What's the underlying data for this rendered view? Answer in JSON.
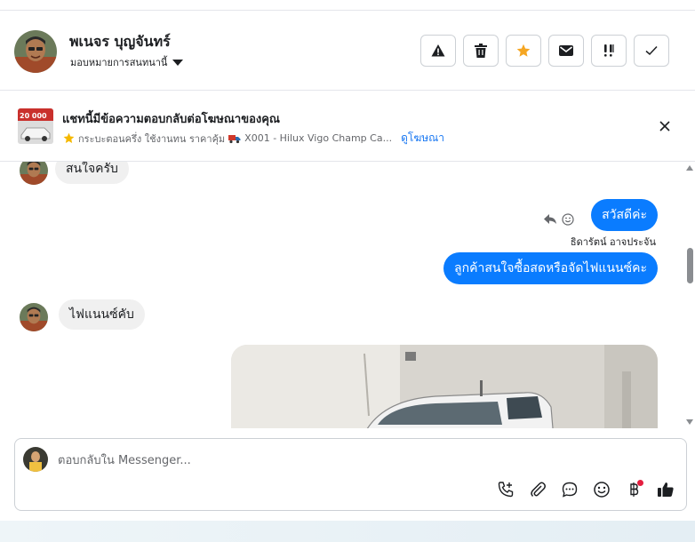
{
  "header": {
    "name": "พเนจร บุญจันทร์",
    "assign_label": "มอบหมายการสนทนานี้",
    "actions": [
      {
        "icon": "warning-icon"
      },
      {
        "icon": "trash-icon"
      },
      {
        "icon": "star-icon"
      },
      {
        "icon": "mail-icon"
      },
      {
        "icon": "priority-icon"
      },
      {
        "icon": "check-icon"
      }
    ]
  },
  "ad_banner": {
    "thumb_text": "20 000",
    "title": "แชทนี้มีข้อความตอบกลับต่อโฆษณาของคุณ",
    "subtitle": "กระบะตอนครึ่ง ใช้งานทน ราคาคุ้ม",
    "subtitle_item": "X001 - Hilux Vigo Champ Ca...",
    "link": "ดูโฆษณา"
  },
  "messages": [
    {
      "direction": "incoming",
      "text": "สนใจครับ"
    },
    {
      "direction": "outgoing",
      "text": "สวัสดีค่ะ",
      "sender": "ธิดารัตน์ อาจประจัน"
    },
    {
      "direction": "outgoing",
      "text": "ลูกค้าสนใจซื้อสดหรือจัดไฟแนนซ์คะ"
    },
    {
      "direction": "incoming",
      "text": "ไฟแนนซ์คับ"
    },
    {
      "direction": "outgoing",
      "type": "image"
    }
  ],
  "composer": {
    "placeholder": "ตอบกลับใน Messenger...",
    "tools": [
      "add-call-icon",
      "attachment-icon",
      "saved-replies-icon",
      "emoji-icon",
      "payment-icon",
      "like-icon"
    ]
  },
  "colors": {
    "outgoing_bubble": "#0a7cff",
    "incoming_bubble": "#f0f0f0",
    "link": "#1877f2",
    "star": "#f5a623",
    "notification_dot": "#e41e3f"
  }
}
